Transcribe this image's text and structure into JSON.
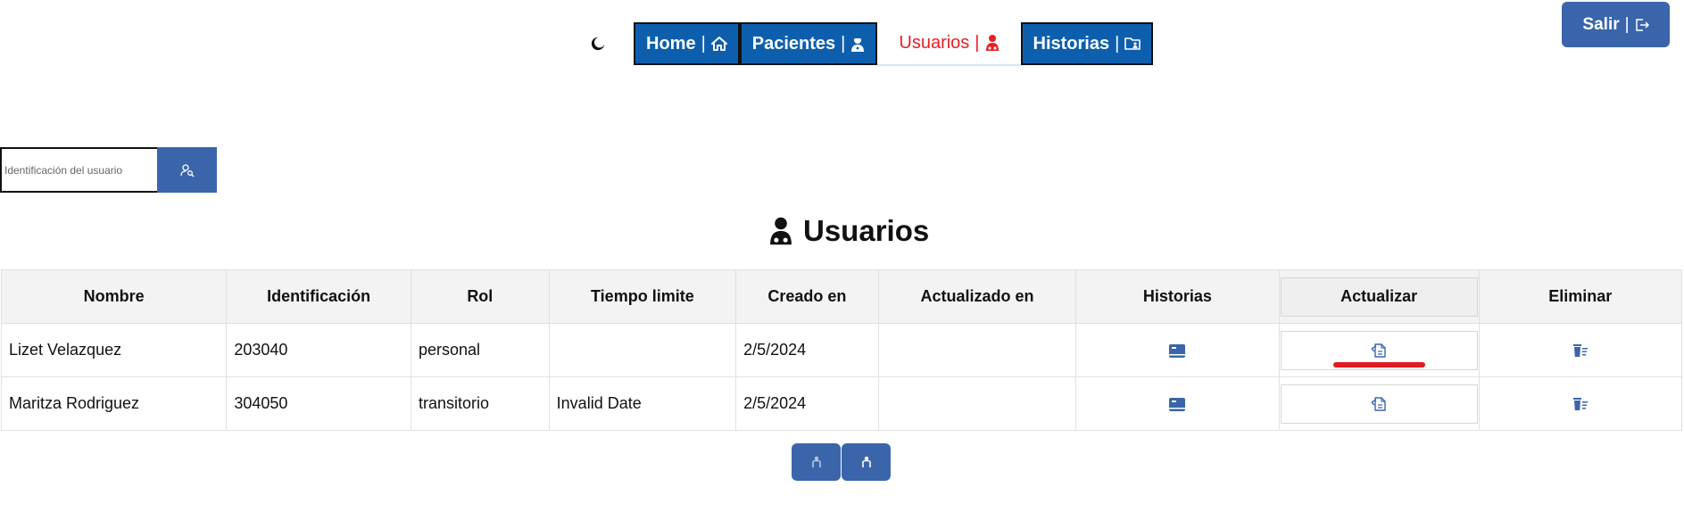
{
  "nav": {
    "theme_icon": "moon-icon",
    "tabs": [
      {
        "label": "Home",
        "sep": "|",
        "icon": "home-icon"
      },
      {
        "label": "Pacientes",
        "sep": "|",
        "icon": "doctor-icon"
      },
      {
        "label": "Usuarios",
        "sep": "|",
        "icon": "user-doctor-icon",
        "active": true
      },
      {
        "label": "Historias",
        "sep": "|",
        "icon": "folder-user-icon"
      }
    ]
  },
  "logout": {
    "label": "Salir",
    "sep": "|",
    "icon": "logout-icon"
  },
  "search": {
    "placeholder": "Identificación del usuario",
    "value": "",
    "button_icon": "user-search-icon"
  },
  "page_title": "Usuarios",
  "table": {
    "columns": [
      "Nombre",
      "Identificación",
      "Rol",
      "Tiempo limite",
      "Creado en",
      "Actualizado en",
      "Historias",
      "Actualizar",
      "Eliminar"
    ],
    "rows": [
      {
        "nombre": "Lizet Velazquez",
        "identificacion": "203040",
        "rol": "personal",
        "tiempo_limite": "",
        "creado_en": "2/5/2024",
        "actualizado_en": ""
      },
      {
        "nombre": "Maritza Rodriguez",
        "identificacion": "304050",
        "rol": "transitorio",
        "tiempo_limite": "Invalid Date",
        "creado_en": "2/5/2024",
        "actualizado_en": ""
      }
    ]
  },
  "pagination": {
    "prev_icon": "person-prev-icon",
    "next_icon": "person-next-icon"
  },
  "colors": {
    "primary": "#3a65aa",
    "nav_blue": "#0d5fae",
    "active_red": "#ee1c23",
    "highlight": "#e01b24"
  }
}
